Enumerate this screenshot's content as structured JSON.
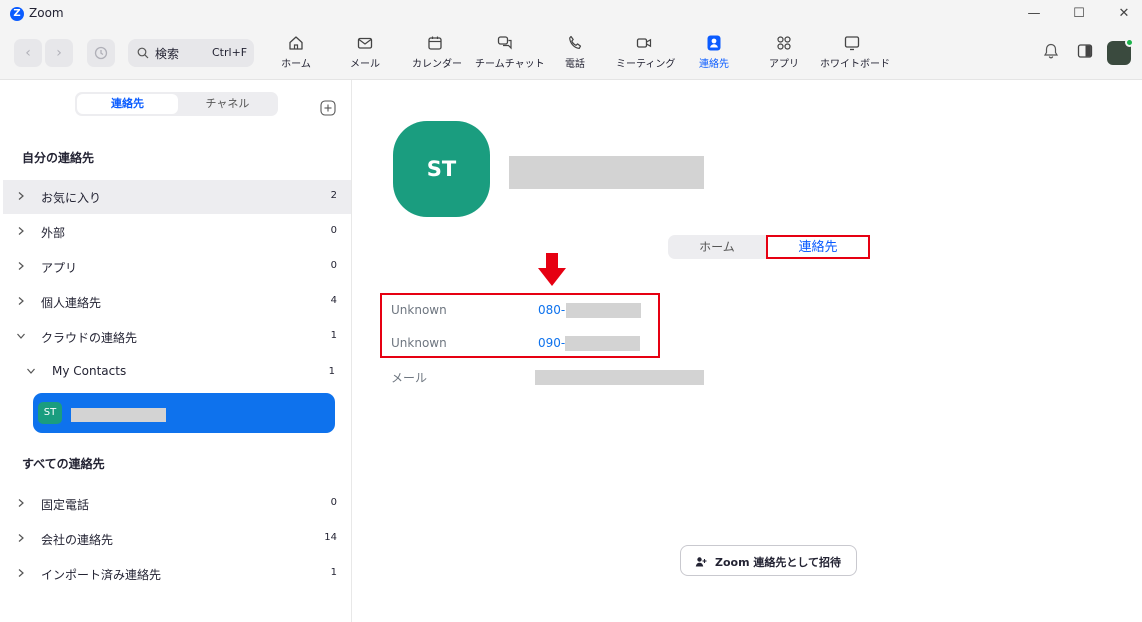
{
  "window": {
    "title": "Zoom",
    "logo_letter": "Z"
  },
  "toolbar": {
    "search_label": "検索",
    "search_shortcut": "Ctrl+F",
    "tabs": [
      {
        "label": "ホーム",
        "icon": "home-icon"
      },
      {
        "label": "メール",
        "icon": "mail-icon"
      },
      {
        "label": "カレンダー",
        "icon": "calendar-icon"
      },
      {
        "label": "チームチャット",
        "icon": "chat-icon"
      },
      {
        "label": "電話",
        "icon": "phone-icon"
      },
      {
        "label": "ミーティング",
        "icon": "video-icon"
      },
      {
        "label": "連絡先",
        "icon": "contacts-icon",
        "active": true
      },
      {
        "label": "アプリ",
        "icon": "apps-icon"
      },
      {
        "label": "ホワイトボード",
        "icon": "whiteboard-icon"
      }
    ]
  },
  "sidebar": {
    "segments": {
      "contacts": "連絡先",
      "channels": "チャネル"
    },
    "my_contacts_heading": "自分の連絡先",
    "groups": [
      {
        "label": "お気に入り",
        "count": "2"
      },
      {
        "label": "外部",
        "count": "0"
      },
      {
        "label": "アプリ",
        "count": "0"
      },
      {
        "label": "個人連絡先",
        "count": "4"
      },
      {
        "label": "クラウドの連絡先",
        "count": "1"
      }
    ],
    "subgroup": {
      "label": "My Contacts",
      "count": "1"
    },
    "selected_contact": {
      "initials": "ST"
    },
    "all_contacts_heading": "すべての連絡先",
    "all_groups": [
      {
        "label": "固定電話",
        "count": "0"
      },
      {
        "label": "会社の連絡先",
        "count": "14"
      },
      {
        "label": "インポート済み連絡先",
        "count": "1"
      }
    ]
  },
  "profile": {
    "initials": "ST",
    "tabs": {
      "home": "ホーム",
      "contact": "連絡先"
    },
    "fields": [
      {
        "label": "Unknown",
        "value": "080-"
      },
      {
        "label": "Unknown",
        "value": "090-"
      },
      {
        "label": "メール",
        "value": ""
      }
    ],
    "invite_button": "Zoom 連絡先として招待"
  },
  "colors": {
    "accent": "#0b5cff",
    "selected_row": "#0e72ed",
    "avatar_green": "#1a9d7f",
    "annotation_red": "#e60012"
  }
}
